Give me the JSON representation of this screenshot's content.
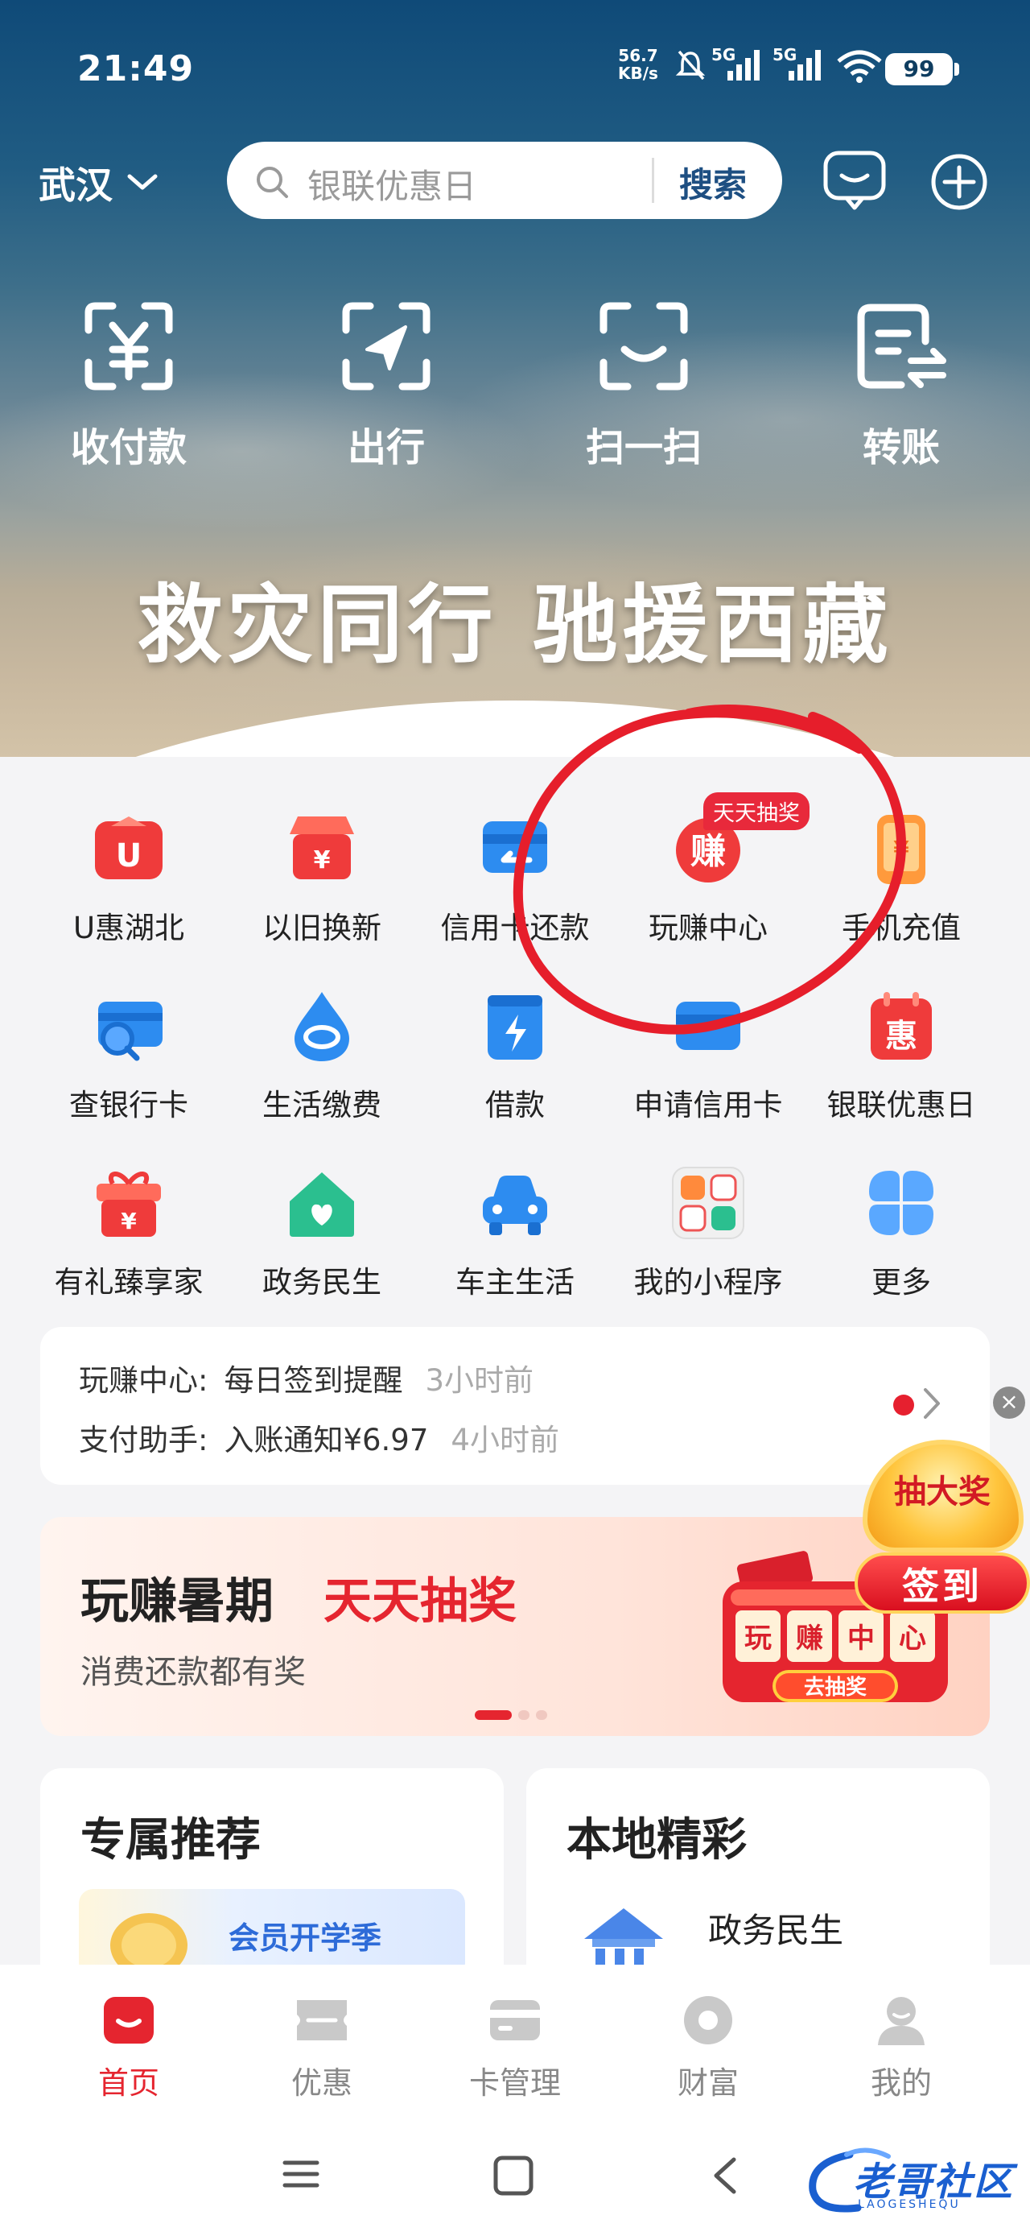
{
  "status_bar": {
    "time": "21:49",
    "net_speed_value": "56.7",
    "net_speed_unit": "KB/s",
    "net1": "5G",
    "net2": "5G",
    "battery": "99"
  },
  "top_bar": {
    "city": "武汉",
    "search_placeholder": "银联优惠日",
    "search_button": "搜索"
  },
  "quick_actions": [
    "收付款",
    "出行",
    "扫一扫",
    "转账"
  ],
  "hero_slogan": "救灾同行 驰援西藏",
  "grid": {
    "row1": [
      "U惠湖北",
      "以旧换新",
      "信用卡还款",
      "玩赚中心",
      "手机充值"
    ],
    "row2": [
      "查银行卡",
      "生活缴费",
      "借款",
      "申请信用卡",
      "银联优惠日"
    ],
    "row3": [
      "有礼臻享家",
      "政务民生",
      "车主生活",
      "我的小程序",
      "更多"
    ],
    "badge": "天天抽奖"
  },
  "notices": [
    {
      "key": "玩赚中心:",
      "value": "每日签到提醒",
      "time": "3小时前"
    },
    {
      "key": "支付助手:",
      "value": "入账通知¥6.97",
      "time": "4小时前"
    }
  ],
  "float_lottery": {
    "top": "抽大奖",
    "button": "签到"
  },
  "banner": {
    "title1": "玩赚暑期",
    "title2": "天天抽奖",
    "subtitle": "消费还款都有奖",
    "slot_chars": [
      "玩",
      "赚",
      "中",
      "心"
    ],
    "slot_button": "去抽奖"
  },
  "cards": {
    "left": {
      "title": "专属推荐",
      "item": "会员开学季"
    },
    "right": {
      "title": "本地精彩",
      "item": "政务民生"
    }
  },
  "tabs": [
    "首页",
    "优惠",
    "卡管理",
    "财富",
    "我的"
  ],
  "watermark": {
    "text": "老哥社区",
    "sub": "LAOGESHEQU"
  },
  "colors": {
    "brand_red": "#e5252f",
    "hero_blue": "#1e4f82",
    "annotation_red": "#e61e2b"
  }
}
